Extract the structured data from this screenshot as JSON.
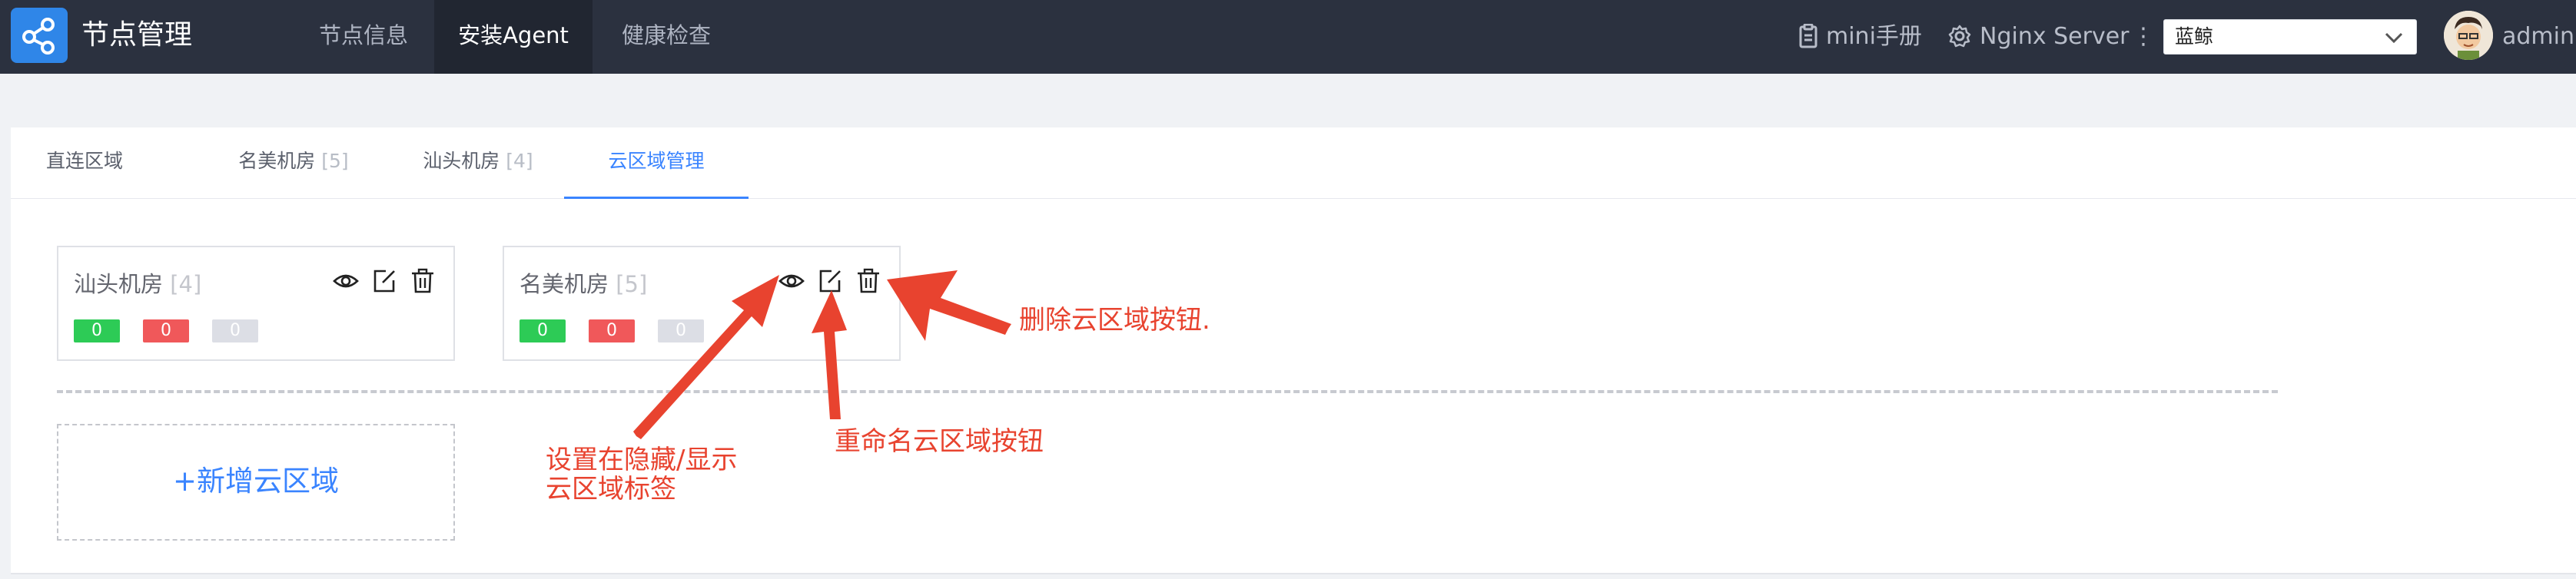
{
  "header": {
    "app_title": "节点管理",
    "nav": [
      "节点信息",
      "安装Agent",
      "健康检查"
    ],
    "active_nav": "安装Agent",
    "manual_label": "mini手册",
    "server_label": "Nginx Server",
    "more_glyph": "⋮",
    "business_select": "蓝鲸",
    "user": "admin"
  },
  "tabs": [
    {
      "label": "直连区域",
      "count": ""
    },
    {
      "label": "名美机房",
      "count": "[5]"
    },
    {
      "label": "汕头机房",
      "count": "[4]"
    },
    {
      "label": "云区域管理",
      "count": ""
    }
  ],
  "active_tab": "云区域管理",
  "regions": [
    {
      "name": "汕头机房",
      "count": "[4]",
      "normal": "0",
      "abnormal": "0",
      "unknown": "0"
    },
    {
      "name": "名美机房",
      "count": "[5]",
      "normal": "0",
      "abnormal": "0",
      "unknown": "0"
    }
  ],
  "add_region_label": "+新增云区域",
  "annotations": {
    "delete": "删除云区域按钮.",
    "rename": "重命名云区域按钮",
    "visibility_line1": "设置在隐藏/显示",
    "visibility_line2": "云区域标签"
  },
  "colors": {
    "topbar": "#2b313f",
    "accent": "#3a84ff",
    "normal": "#2dcb56",
    "abnormal": "#f0585a",
    "unknown": "#dcdee5",
    "annotation": "#e8432f"
  },
  "icons": [
    "node-logo-icon",
    "manual-icon",
    "gear-icon",
    "chevron-down-icon",
    "eye-icon",
    "edit-icon",
    "trash-icon"
  ]
}
